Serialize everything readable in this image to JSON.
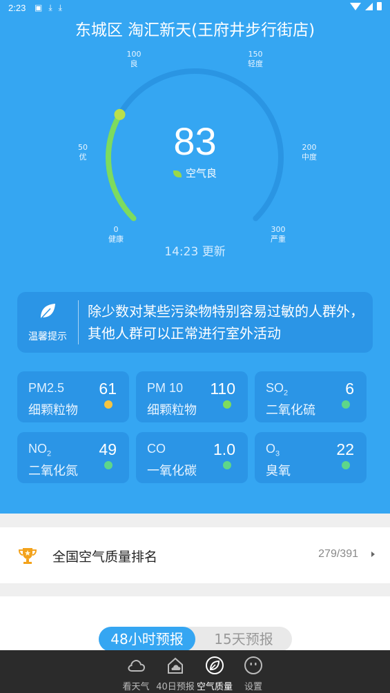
{
  "status_bar": {
    "time": "2:23"
  },
  "location": "东城区 淘汇新天(王府井步行街店)",
  "gauge": {
    "aqi": "83",
    "level": "空气良",
    "update": "14:23 更新",
    "fraction": 0.277,
    "ticks": [
      {
        "value": "0",
        "label": "健康"
      },
      {
        "value": "50",
        "label": "优"
      },
      {
        "value": "100",
        "label": "良"
      },
      {
        "value": "150",
        "label": "轻度"
      },
      {
        "value": "200",
        "label": "中度"
      },
      {
        "value": "300",
        "label": "严重"
      }
    ]
  },
  "tip": {
    "title": "温馨提示",
    "text": "除少数对某些污染物特别容易过敏的人群外，其他人群可以正常进行室外活动"
  },
  "pollutants": [
    {
      "name": "PM2.5",
      "sub": "",
      "desc": "细颗粒物",
      "value": "61",
      "color": "#f5c542"
    },
    {
      "name": "PM 10",
      "sub": "",
      "desc": "细颗粒物",
      "value": "110",
      "color": "#7fdc5a"
    },
    {
      "name": "SO",
      "sub": "2",
      "desc": "二氧化硫",
      "value": "6",
      "color": "#5ed68a"
    },
    {
      "name": "NO",
      "sub": "2",
      "desc": "二氧化氮",
      "value": "49",
      "color": "#5ed68a"
    },
    {
      "name": "CO",
      "sub": "",
      "desc": "一氧化碳",
      "value": "1.0",
      "color": "#5ed68a"
    },
    {
      "name": "O",
      "sub": "3",
      "desc": "臭氧",
      "value": "22",
      "color": "#5ed68a"
    }
  ],
  "ranking": {
    "label": "全国空气质量排名",
    "value": "279/391"
  },
  "forecast_tabs": {
    "active": "48小时预报",
    "inactive": "15天预报"
  },
  "nav": [
    {
      "label": "看天气",
      "icon": "cloud-icon"
    },
    {
      "label": "40日预报",
      "icon": "home-cloud-icon"
    },
    {
      "label": "空气质量",
      "icon": "leaf-circle-icon"
    },
    {
      "label": "设置",
      "icon": "face-icon"
    }
  ],
  "colors": {
    "primary": "#35a6f2",
    "card": "#2b95e6",
    "gauge_green": "#7ddb5f"
  }
}
